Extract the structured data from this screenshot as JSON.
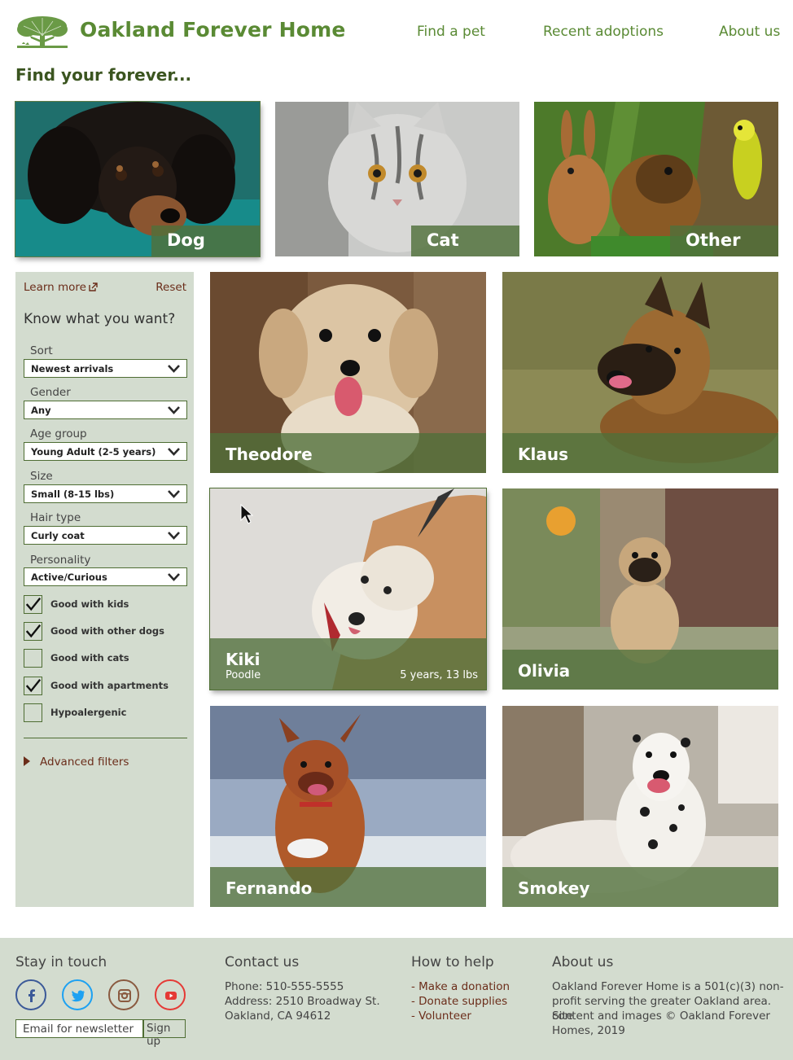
{
  "header": {
    "site_title": "Oakland Forever Home",
    "nav": [
      "Find a pet",
      "Recent adoptions",
      "About us"
    ],
    "brand_color": "#5a8a34"
  },
  "section_title": "Find your forever...",
  "categories": [
    {
      "label": "Dog",
      "selected": true
    },
    {
      "label": "Cat",
      "selected": false
    },
    {
      "label": "Other",
      "selected": false
    }
  ],
  "sidebar": {
    "learn_more": "Learn more",
    "reset": "Reset",
    "title": "Know what you want?",
    "filters": [
      {
        "label": "Sort",
        "value": "Newest arrivals"
      },
      {
        "label": "Gender",
        "value": "Any"
      },
      {
        "label": "Age group",
        "value": "Young Adult (2-5 years)"
      },
      {
        "label": "Size",
        "value": "Small (8-15 lbs)"
      },
      {
        "label": "Hair type",
        "value": "Curly coat"
      },
      {
        "label": "Personality",
        "value": "Active/Curious"
      }
    ],
    "checkboxes": [
      {
        "label": "Good with kids",
        "checked": true
      },
      {
        "label": "Good with other dogs",
        "checked": true
      },
      {
        "label": "Good with cats",
        "checked": false
      },
      {
        "label": "Good with apartments",
        "checked": true
      },
      {
        "label": "Hypoalergenic",
        "checked": false
      }
    ],
    "advanced": "Advanced filters"
  },
  "pets": [
    {
      "name": "Theodore"
    },
    {
      "name": "Klaus"
    },
    {
      "name": "Kiki",
      "breed": "Poodle",
      "meta": "5 years, 13 lbs",
      "selected": true
    },
    {
      "name": "Olivia"
    },
    {
      "name": "Fernando"
    },
    {
      "name": "Smokey"
    }
  ],
  "footer": {
    "stay_in_touch": "Stay in touch",
    "social": [
      "facebook-icon",
      "twitter-icon",
      "instagram-icon",
      "youtube-icon"
    ],
    "email_placeholder": "Email for newsletter",
    "signup": "Sign up",
    "contact_title": "Contact us",
    "phone": "Phone: 510-555-5555",
    "address_1": "Address: 2510 Broadway St.",
    "address_2": "Oakland, CA 94612",
    "help_title": "How to help",
    "help_links": [
      "- Make a donation",
      "- Donate supplies",
      "- Volunteer"
    ],
    "about_title": "About us",
    "about_lines": [
      "Oakland Forever Home is a 501(c)(3) non-",
      "profit serving the greater Oakland area. Site",
      "content and images © Oakland Forever",
      "Homes, 2019"
    ]
  },
  "colors": {
    "accent": "#5a8a34",
    "link": "#6b2d1a",
    "panel": "#d3dccf"
  }
}
